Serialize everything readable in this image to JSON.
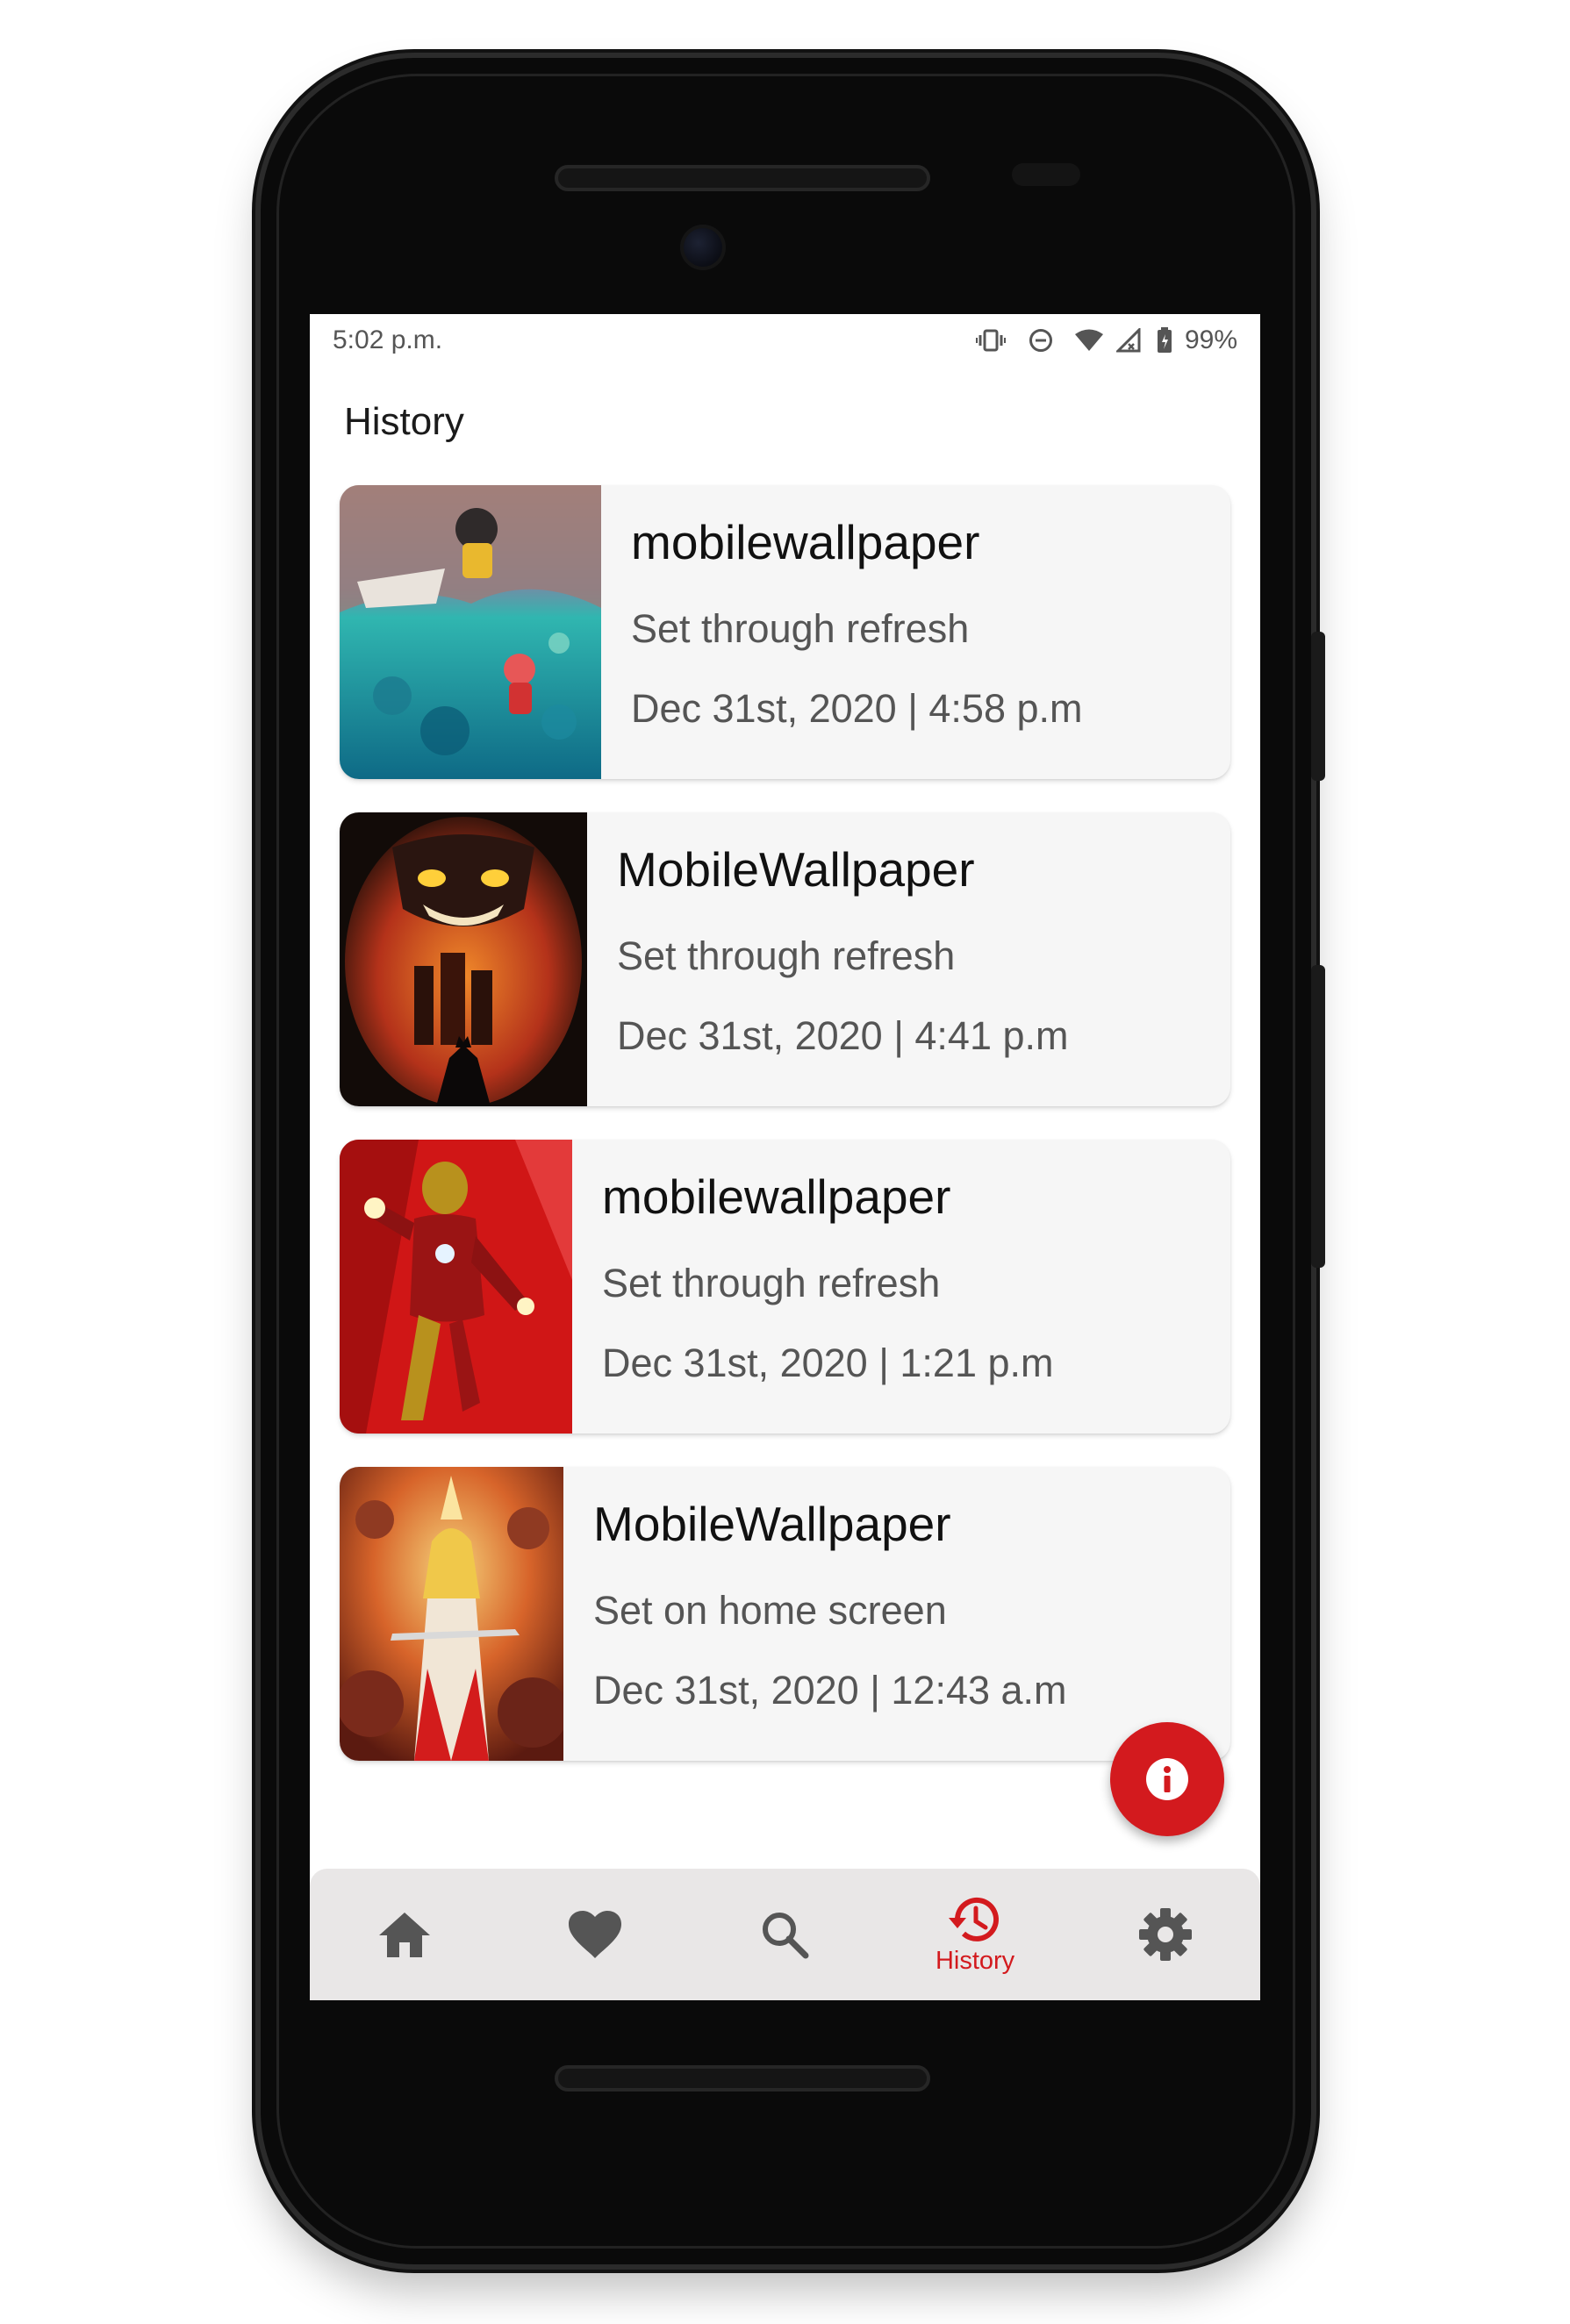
{
  "status_bar": {
    "time": "5:02 p.m.",
    "battery": "99%",
    "icons": [
      "vibrate-icon",
      "dnd-icon",
      "wifi-icon",
      "signal-icon",
      "battery-icon"
    ]
  },
  "page": {
    "title": "History"
  },
  "history": [
    {
      "title": "mobilewallpaper",
      "subtitle": "Set through refresh",
      "date": "Dec 31st, 2020 | 4:58 p.m",
      "image": "ocean-scene-illustration"
    },
    {
      "title": "MobileWallpaper",
      "subtitle": "Set through refresh",
      "date": "Dec 31st, 2020 | 4:41 p.m",
      "image": "joker-batman-illustration"
    },
    {
      "title": "mobilewallpaper",
      "subtitle": "Set through refresh",
      "date": "Dec 31st, 2020 | 1:21 p.m",
      "image": "iron-man-illustration"
    },
    {
      "title": "MobileWallpaper",
      "subtitle": "Set on home screen",
      "date": "Dec 31st, 2020 | 12:43 a.m",
      "image": "she-ra-illustration"
    }
  ],
  "fab": {
    "icon": "info-icon"
  },
  "bottom_nav": {
    "items": [
      {
        "icon": "home-icon",
        "label": ""
      },
      {
        "icon": "heart-icon",
        "label": ""
      },
      {
        "icon": "search-icon",
        "label": ""
      },
      {
        "icon": "history-icon",
        "label": "History"
      },
      {
        "icon": "settings-icon",
        "label": ""
      }
    ],
    "active_index": 3
  },
  "colors": {
    "accent": "#d31a1e",
    "icon_gray": "#555555",
    "card_bg": "#f6f6f6",
    "nav_bg": "#e9e7e7"
  }
}
